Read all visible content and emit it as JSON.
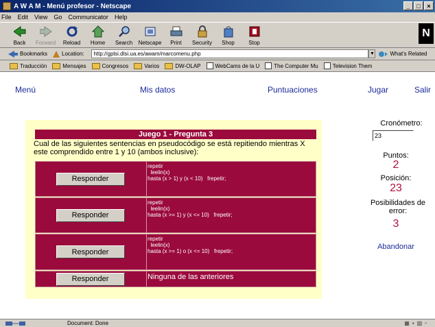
{
  "window": {
    "title": "A W A M - Menú profesor - Netscape",
    "minimize": "_",
    "maximize": "□",
    "close": "×"
  },
  "menubar": [
    "File",
    "Edit",
    "View",
    "Go",
    "Communicator",
    "Help"
  ],
  "toolbar": {
    "back": "Back",
    "forward": "Forward",
    "reload": "Reload",
    "home": "Home",
    "search": "Search",
    "netscape": "Netscape",
    "print": "Print",
    "security": "Security",
    "shop": "Shop",
    "stop": "Stop"
  },
  "location": {
    "bookmarks": "Bookmarks",
    "label": "Location:",
    "url": "http://gplsi.dlsi.ua.es/awam/marcomenu.php",
    "whats_related": "What's Related"
  },
  "personal_toolbar": [
    "Traducción",
    "Mensajes",
    "Congresos",
    "Varios",
    "DW-OLAP",
    "WebCams de la U",
    "The Computer Mu",
    "Television Them"
  ],
  "nav": {
    "menu": "Menú",
    "mis_datos": "Mis datos",
    "puntuaciones": "Puntuaciones",
    "jugar": "Jugar",
    "salir": "Salir"
  },
  "question": {
    "header": "Juego 1 - Pregunta 3",
    "text": "Cual de las siguientes sentencias en pseudocódigo se está repitiendo mientras X este comprendido entre 1 y 10 (ambos inclusive):",
    "button_label": "Responder",
    "answers": [
      "repetir\n  leelin(x)\nhasta (x > 1) y (x < 10)   frepetir;",
      "repetir\n  leelin(x)\nhasta (x >= 1) y (x <= 10)   frepetir;",
      "repetir\n  leelin(x)\nhasta (x >= 1) o (x <= 10)   frepetir;",
      "Ninguna de las anteriores"
    ]
  },
  "sidebar": {
    "cronometro_label": "Cronómetro:",
    "cronometro_value": "23",
    "puntos_label": "Puntos:",
    "puntos_value": "2",
    "posicion_label": "Posición:",
    "posicion_value": "23",
    "error_label": "Posibilidades de error:",
    "error_value": "3",
    "abandonar": "Abandonar"
  },
  "status": {
    "text": "Document: Done"
  },
  "colors": {
    "accent": "#9b0a3c",
    "panel": "#ffffc8",
    "link": "#1a2a9a"
  }
}
